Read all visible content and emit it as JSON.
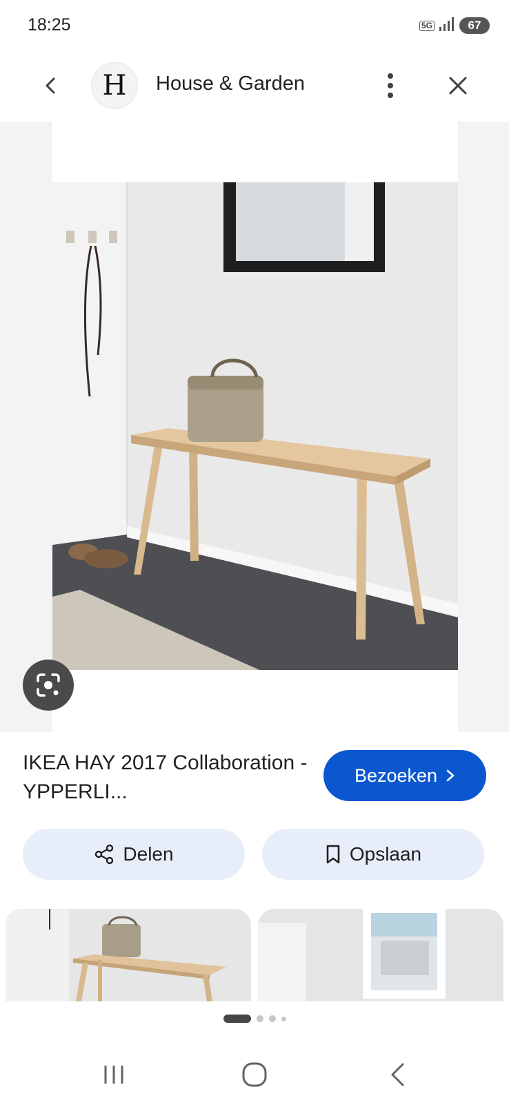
{
  "status_bar": {
    "time": "18:25",
    "network": "5G",
    "battery": "67"
  },
  "header": {
    "back_icon": "chevron-left-icon",
    "site_logo_letter": "H",
    "site_name": "House & Garden",
    "more_icon": "more-vert-icon",
    "close_icon": "close-icon"
  },
  "result": {
    "title": "IKEA HAY 2017 Collaboration - YPPERLI...",
    "visit_label": "Bezoeken",
    "share_label": "Delen",
    "save_label": "Opslaan"
  },
  "pager": {
    "pages": 4,
    "active_index": 0
  },
  "colors": {
    "primary_button": "#0b57d0",
    "action_button_bg": "#e8eef9",
    "viewer_bg": "#f1f3f4"
  }
}
